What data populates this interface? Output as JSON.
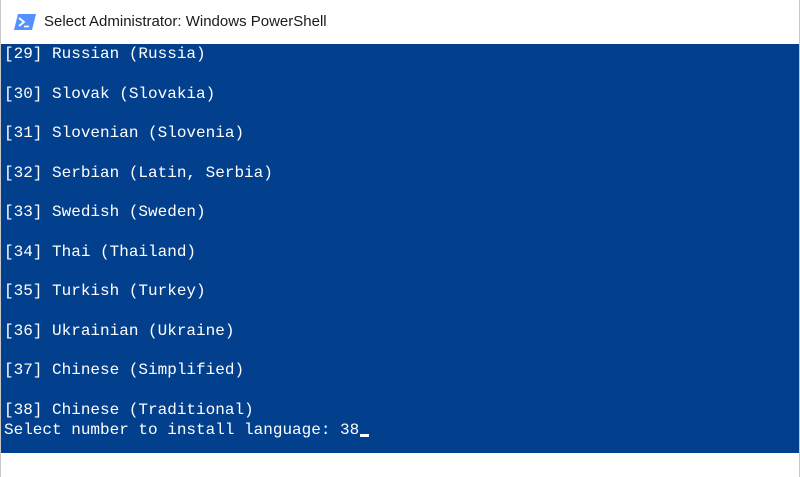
{
  "window": {
    "title": "Select Administrator: Windows PowerShell",
    "icon": "powershell-icon"
  },
  "console": {
    "lines": [
      "[29] Russian (Russia)",
      "[30] Slovak (Slovakia)",
      "[31] Slovenian (Slovenia)",
      "[32] Serbian (Latin, Serbia)",
      "[33] Swedish (Sweden)",
      "[34] Thai (Thailand)",
      "[35] Turkish (Turkey)",
      "[36] Ukrainian (Ukraine)",
      "[37] Chinese (Simplified)",
      "[38] Chinese (Traditional)"
    ],
    "prompt": "Select number to install language: 38",
    "colors": {
      "background": "#023f8c",
      "text": "#ffffff"
    }
  }
}
